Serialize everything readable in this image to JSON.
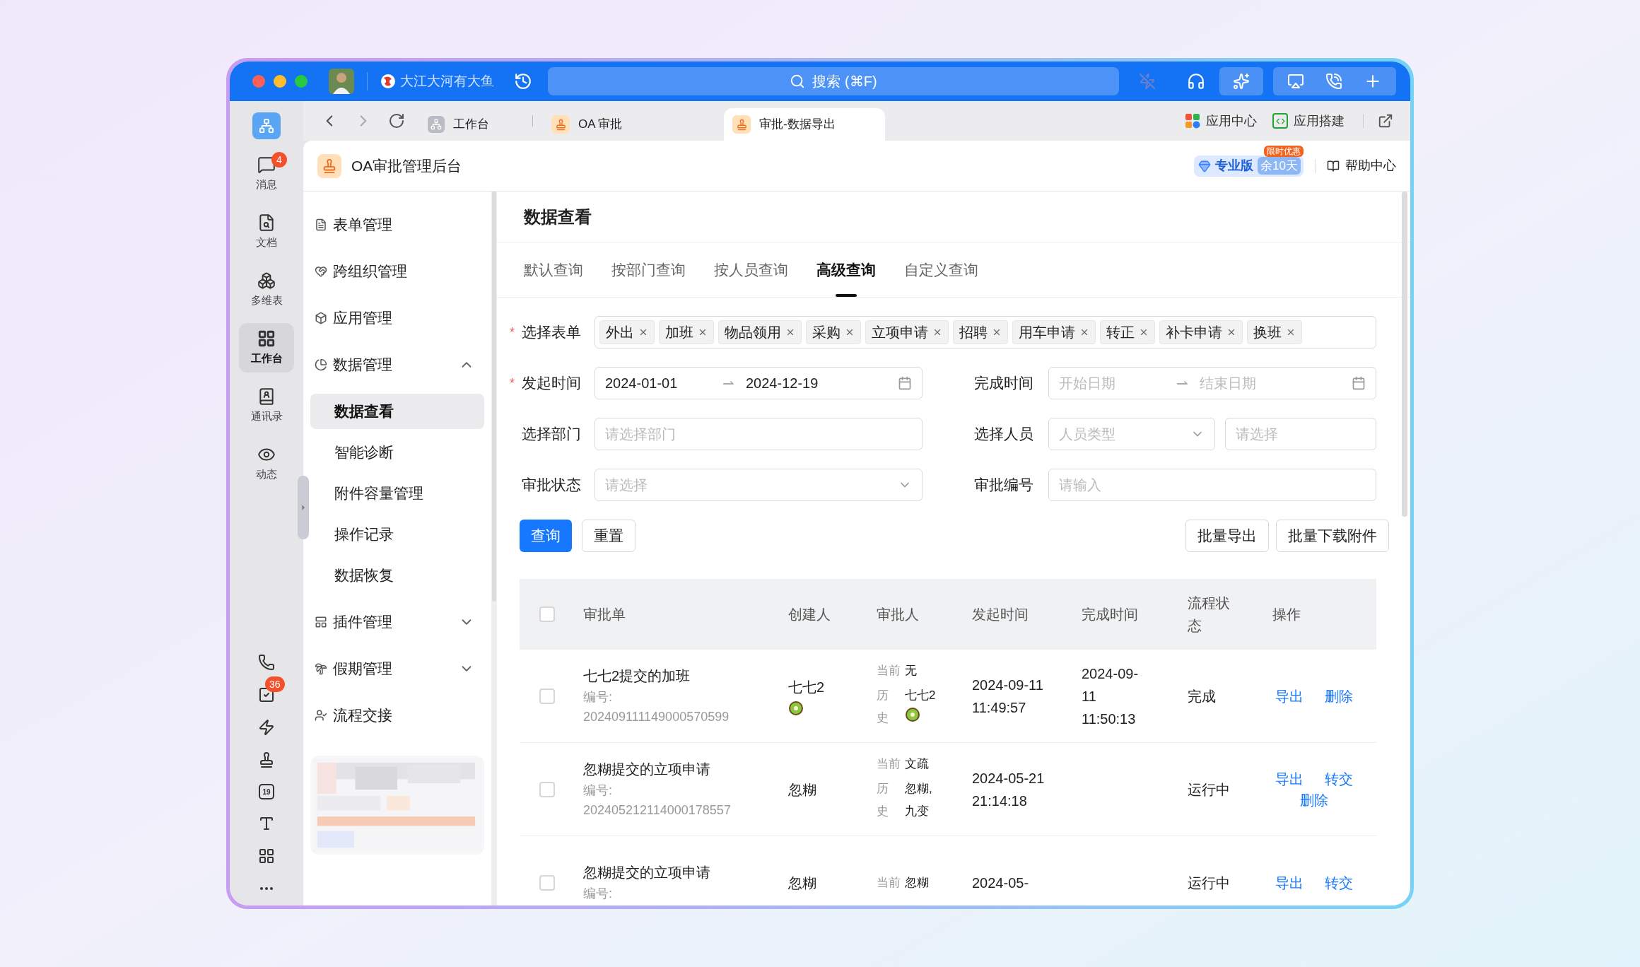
{
  "titlebar": {
    "account": "大江大河有大鱼",
    "search": "搜索 (⌘F)"
  },
  "tabs": [
    {
      "label": "工作台",
      "selected": false
    },
    {
      "label": "OA 审批",
      "selected": false
    },
    {
      "label": "审批-数据导出",
      "selected": true
    }
  ],
  "toolbar_links": [
    "应用中心",
    "应用搭建"
  ],
  "rail": {
    "items": [
      {
        "label": "消息",
        "badge": "4",
        "selected": false
      },
      {
        "label": "文档",
        "selected": false
      },
      {
        "label": "多维表",
        "selected": false
      },
      {
        "label": "工作台",
        "selected": true
      },
      {
        "label": "通讯录",
        "selected": false
      },
      {
        "label": "动态",
        "selected": false
      }
    ],
    "tasks_badge": "36",
    "calendar_day": "19"
  },
  "app_header": {
    "title": "OA审批管理后台",
    "plan": "专业版",
    "remaining": "余10天",
    "promo": "限时优惠",
    "help": "帮助中心"
  },
  "nav": [
    {
      "label": "表单管理"
    },
    {
      "label": "跨组织管理"
    },
    {
      "label": "应用管理"
    },
    {
      "label": "数据管理",
      "expanded": true,
      "children": [
        {
          "label": "数据查看",
          "selected": true
        },
        {
          "label": "智能诊断",
          "selected": false
        },
        {
          "label": "附件容量管理",
          "selected": false
        },
        {
          "label": "操作记录",
          "selected": false
        },
        {
          "label": "数据恢复",
          "selected": false
        }
      ]
    },
    {
      "label": "插件管理",
      "expanded": false
    },
    {
      "label": "假期管理",
      "expanded": false
    },
    {
      "label": "流程交接"
    }
  ],
  "page": {
    "title": "数据查看",
    "tabs": [
      {
        "label": "默认查询",
        "selected": false
      },
      {
        "label": "按部门查询",
        "selected": false
      },
      {
        "label": "按人员查询",
        "selected": false
      },
      {
        "label": "高级查询",
        "selected": true
      },
      {
        "label": "自定义查询",
        "selected": false
      }
    ]
  },
  "form": {
    "forms_filter": {
      "label": "选择表单",
      "required_mark": "*",
      "tags": [
        "外出",
        "加班",
        "物品领用",
        "采购",
        "立项申请",
        "招聘",
        "用车申请",
        "转正",
        "补卡申请",
        "换班"
      ]
    },
    "fields": [
      {
        "kind": "daterange",
        "label": "发起时间",
        "required_mark": "*",
        "start": "2024-01-01",
        "separator": "⇀",
        "end": "2024-12-19"
      },
      {
        "kind": "daterange",
        "label": "完成时间",
        "start_placeholder": "开始日期",
        "separator": "⇀",
        "end_placeholder": "结束日期"
      },
      {
        "kind": "input",
        "label": "选择部门",
        "placeholder": "请选择部门"
      },
      {
        "kind": "person",
        "label": "选择人员",
        "type_placeholder": "人员类型",
        "placeholder": "请选择"
      },
      {
        "kind": "select",
        "label": "审批状态",
        "placeholder": "请选择"
      },
      {
        "kind": "input",
        "label": "审批编号",
        "placeholder": "请输入"
      }
    ],
    "actions": [
      {
        "label": "查询",
        "kind": "primary"
      },
      {
        "label": "重置",
        "kind": "default"
      }
    ],
    "bulk_actions": [
      "批量导出",
      "批量下载附件"
    ]
  },
  "table": {
    "select_all": {
      "checked": false
    },
    "columns": [
      "审批单",
      "创建人",
      "审批人",
      "发起时间",
      "完成时间",
      "流程状态",
      "操作"
    ],
    "rows": [
      {
        "checked": false,
        "title": "七七2提交的加班",
        "code_label": "编号:",
        "code": "202409111149000570599",
        "creator": {
          "name": "七七2",
          "avatar": true
        },
        "current_label": "当前",
        "current": "无",
        "history_label": "历史",
        "history": [
          {
            "name": "七七2",
            "avatar": true
          }
        ],
        "start": "2024-09-11 11:49:57",
        "end": "2024-09-11 11:50:13",
        "status": "完成",
        "actions": [
          "导出",
          "删除"
        ]
      },
      {
        "checked": false,
        "title": "忽糊提交的立项申请",
        "code_label": "编号:",
        "code": "202405212114000178557",
        "creator": {
          "name": "忽糊",
          "avatar": false
        },
        "current_label": "当前",
        "current": "文疏",
        "history_label": "历史",
        "history": [
          {
            "name": "忽糊,",
            "avatar": false
          },
          {
            "name": "九变",
            "avatar": false
          }
        ],
        "start": "2024-05-21 21:14:18",
        "status": "运行中",
        "actions": [
          "导出",
          "转交",
          "删除"
        ]
      },
      {
        "checked": false,
        "title": "忽糊提交的立项申请",
        "code_label": "编号:",
        "creator": {
          "name": "忽糊",
          "avatar": false
        },
        "current_label": "当前",
        "current": "忽糊",
        "start": "2024-05-",
        "status": "运行中",
        "actions": [
          "导出",
          "转交"
        ]
      }
    ]
  }
}
